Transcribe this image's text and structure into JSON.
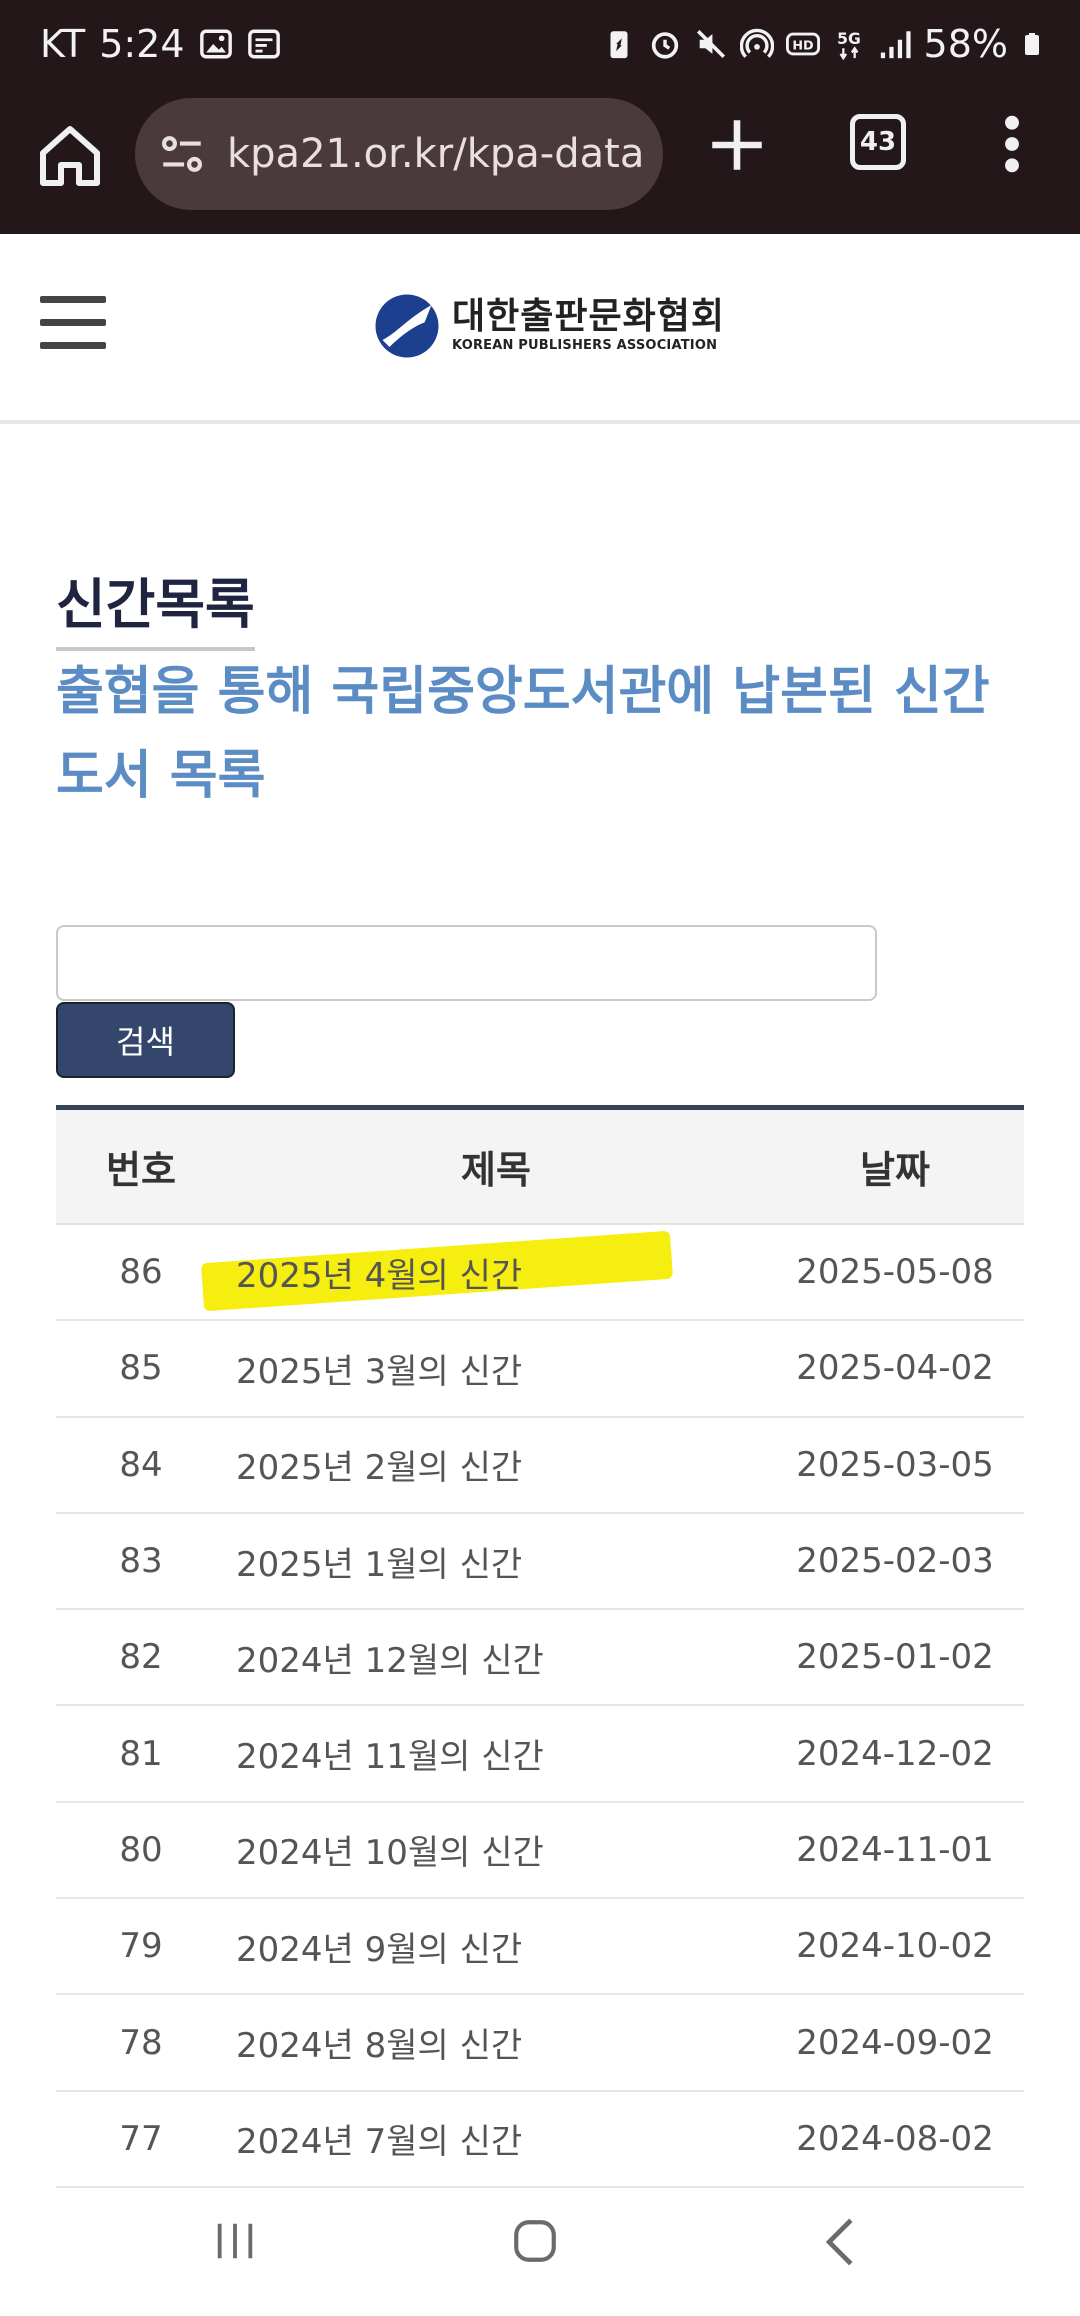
{
  "status_bar": {
    "carrier": "KT",
    "time": "5:24",
    "network": "5G",
    "battery": "58%"
  },
  "browser": {
    "url": "kpa21.or.kr/kpa-data",
    "tab_count": "43"
  },
  "site": {
    "logo_korean": "대한출판문화협회",
    "logo_english": "KOREAN PUBLISHERS ASSOCIATION"
  },
  "page": {
    "title": "신간목록",
    "subtitle": "출협을 통해 국립중앙도서관에 납본된 신간도서 목록"
  },
  "search": {
    "value": "",
    "button_label": "검색"
  },
  "table": {
    "headers": {
      "number": "번호",
      "title": "제목",
      "date": "날짜"
    },
    "rows": [
      {
        "number": "86",
        "title": "2025년 4월의 신간",
        "date": "2025-05-08"
      },
      {
        "number": "85",
        "title": "2025년 3월의 신간",
        "date": "2025-04-02"
      },
      {
        "number": "84",
        "title": "2025년 2월의 신간",
        "date": "2025-03-05"
      },
      {
        "number": "83",
        "title": "2025년 1월의 신간",
        "date": "2025-02-03"
      },
      {
        "number": "82",
        "title": "2024년 12월의 신간",
        "date": "2025-01-02"
      },
      {
        "number": "81",
        "title": "2024년 11월의 신간",
        "date": "2024-12-02"
      },
      {
        "number": "80",
        "title": "2024년 10월의 신간",
        "date": "2024-11-01"
      },
      {
        "number": "79",
        "title": "2024년 9월의 신간",
        "date": "2024-10-02"
      },
      {
        "number": "78",
        "title": "2024년 8월의 신간",
        "date": "2024-09-02"
      },
      {
        "number": "77",
        "title": "2024년 7월의 신간",
        "date": "2024-08-02"
      }
    ]
  },
  "colors": {
    "browser_bg": "#231719",
    "accent_blue": "#5b8cc4",
    "button_navy": "#34466b",
    "highlight_yellow": "#f5ee0f"
  },
  "icons": {
    "home": "home-icon",
    "site_settings": "tune-icon",
    "new_tab": "plus-icon",
    "menu": "more-vert-icon",
    "hamburger": "hamburger-icon"
  }
}
